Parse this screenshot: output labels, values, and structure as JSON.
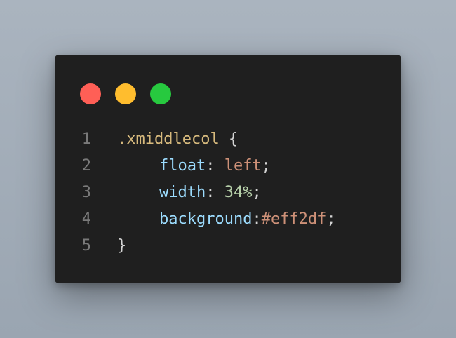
{
  "window": {
    "lights": [
      {
        "name": "close",
        "color": "#ff5f56"
      },
      {
        "name": "minimize",
        "color": "#ffbd2e"
      },
      {
        "name": "maximize",
        "color": "#27c93f"
      }
    ]
  },
  "code": {
    "lines": [
      {
        "number": "1",
        "selector": ".xmiddlecol",
        "open": " {"
      },
      {
        "number": "2",
        "property": "float",
        "colon": ": ",
        "value": "left",
        "semi": ";"
      },
      {
        "number": "3",
        "property": "width",
        "colon": ": ",
        "value": "34%",
        "semi": ";"
      },
      {
        "number": "4",
        "property": "background",
        "colon": ":",
        "value": "#eff2df",
        "semi": ";"
      },
      {
        "number": "5",
        "close": "}"
      }
    ]
  }
}
